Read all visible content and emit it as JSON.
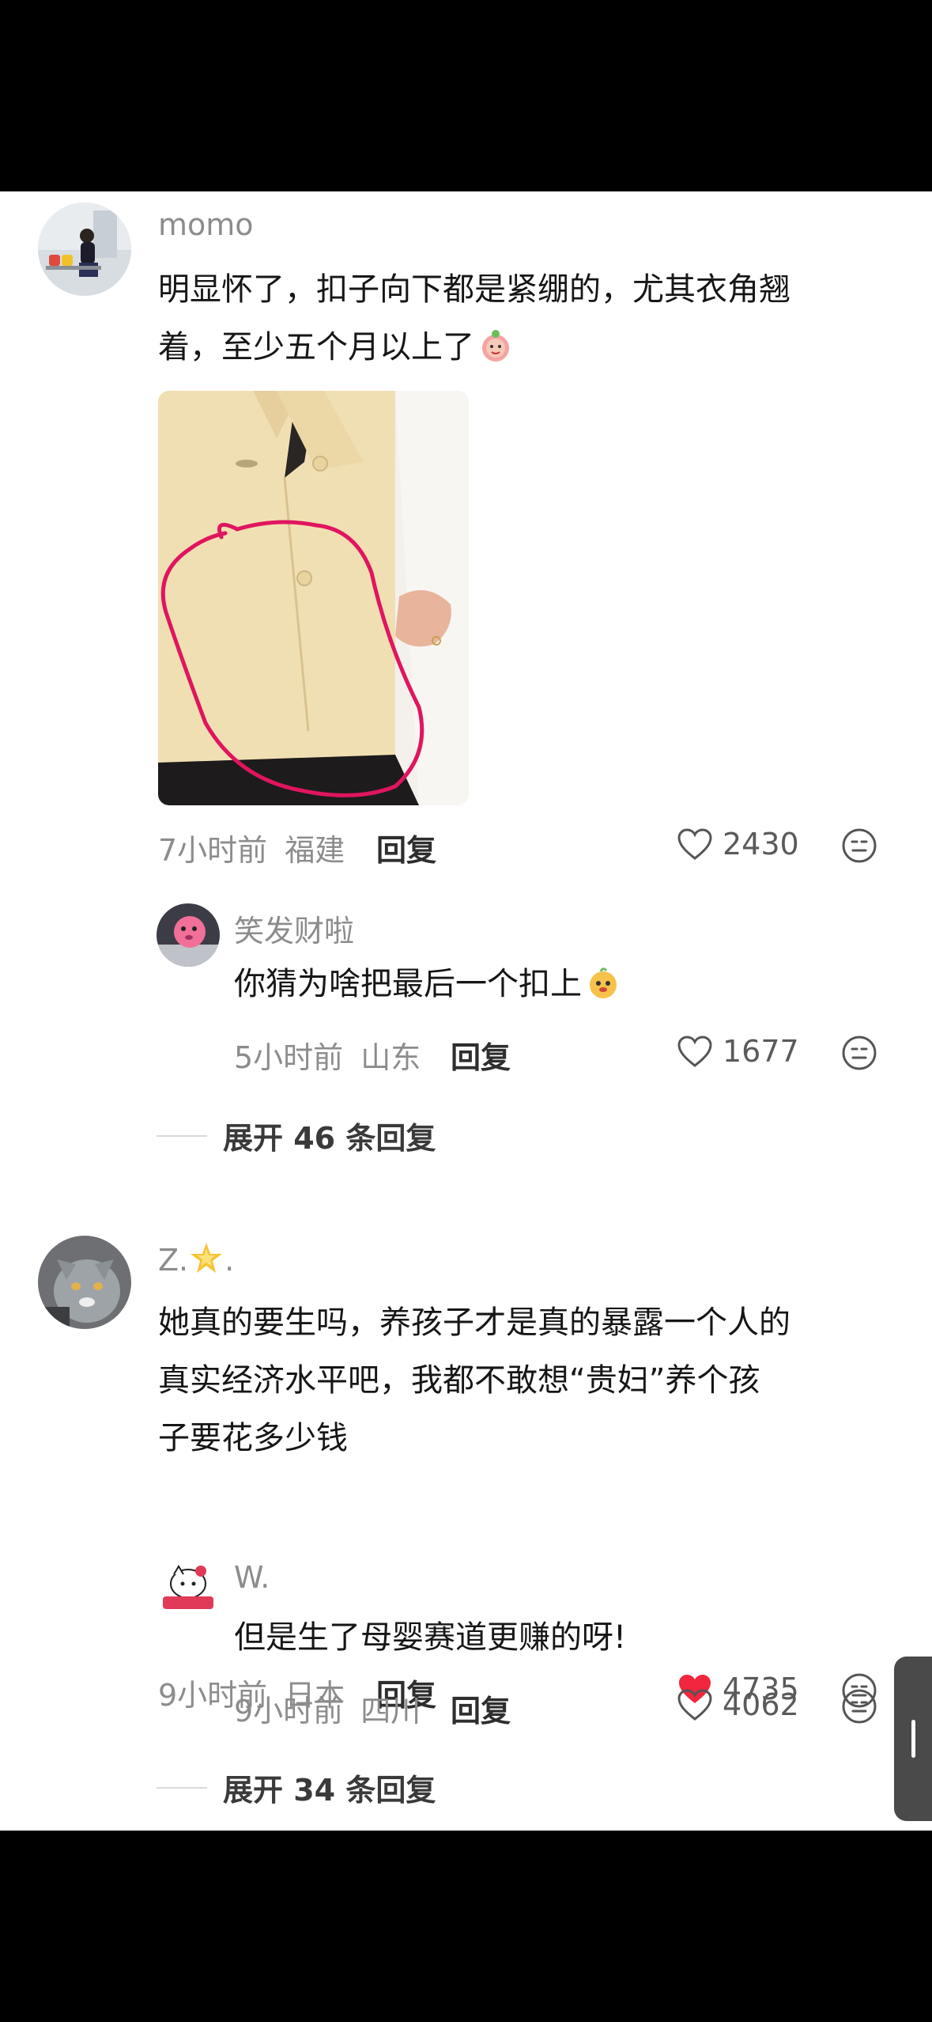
{
  "comments": [
    {
      "username": "momo",
      "text_line1": "明显怀了，扣子向下都是紧绷的，尤其衣角翘",
      "text_line2": "着，至少五个月以上了",
      "time": "7小时前",
      "location": "福建",
      "reply_label": "回复",
      "likes": "2430",
      "liked": false,
      "reply": {
        "username": "笑发财啦",
        "text": "你猜为啥把最后一个扣上",
        "time": "5小时前",
        "location": "山东",
        "reply_label": "回复",
        "likes": "1677",
        "liked": false
      },
      "expand_label": "展开 46 条回复"
    },
    {
      "username": "Z.",
      "text_line1": "她真的要生吗，养孩子才是真的暴露一个人的",
      "text_line2": "真实经济水平吧，我都不敢想“贵妇”养个孩",
      "text_line3": "子要花多少钱",
      "time": "9小时前",
      "location": "日本",
      "reply_label": "回复",
      "likes": "4735",
      "liked": true,
      "reply": {
        "username": "W.",
        "text": "但是生了母婴赛道更赚的呀!",
        "time": "9小时前",
        "location": "四川",
        "reply_label": "回复",
        "likes": "4062",
        "liked": false
      },
      "expand_label": "展开 34 条回复"
    }
  ],
  "colors": {
    "like_active": "#f2263d",
    "annotation_circle": "#e0155f"
  },
  "icons": [
    "heart-outline-icon",
    "heart-filled-icon",
    "emoji-face-icon",
    "star-emoji-icon"
  ]
}
